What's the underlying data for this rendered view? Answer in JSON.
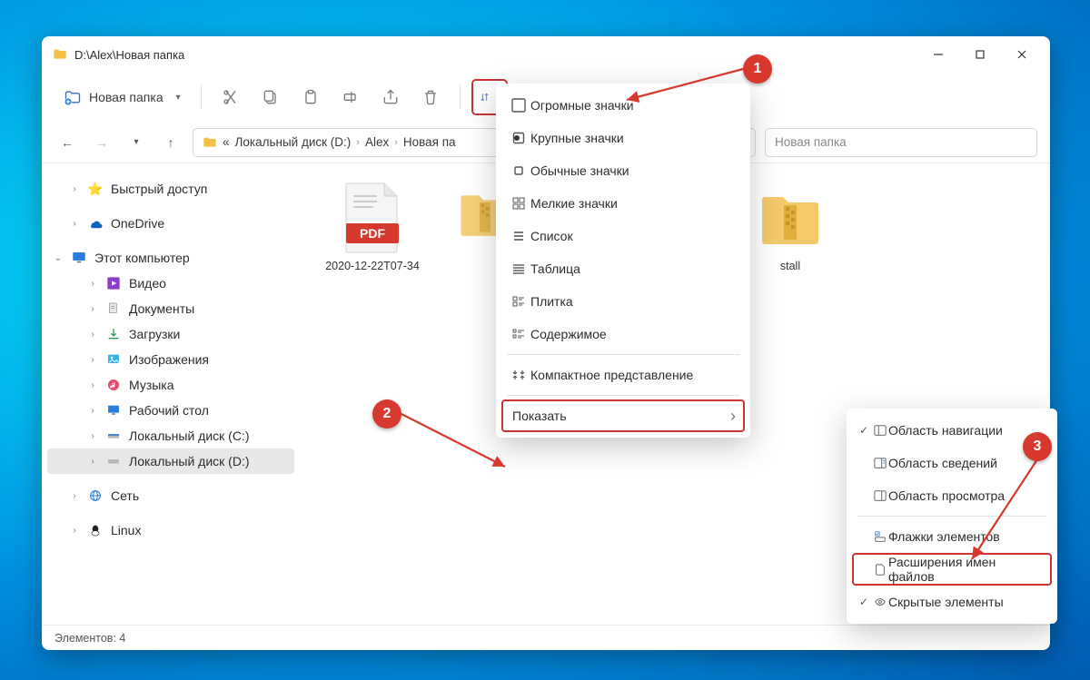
{
  "titlebar": {
    "path": "D:\\Alex\\Новая папка"
  },
  "toolbar": {
    "new_folder": "Новая папка"
  },
  "breadcrumb": {
    "segs": [
      "«",
      "Локальный диск (D:)",
      "Alex",
      "Новая па"
    ]
  },
  "search": {
    "placeholder": "Новая папка"
  },
  "sidebar": {
    "quick": "Быстрый доступ",
    "onedrive": "OneDrive",
    "thispc": "Этот компьютер",
    "video": "Видео",
    "documents": "Документы",
    "downloads": "Загрузки",
    "pictures": "Изображения",
    "music": "Музыка",
    "desktop": "Рабочий стол",
    "diskc": "Локальный диск (C:)",
    "diskd": "Локальный диск (D:)",
    "network": "Сеть",
    "linux": "Linux"
  },
  "files": {
    "pdf": "2020-12-22T07-34",
    "zip1_partial": "",
    "zip2_partial": "stall"
  },
  "status": {
    "count": "Элементов: 4"
  },
  "view_menu": {
    "items": [
      "Огромные значки",
      "Крупные значки",
      "Обычные значки",
      "Мелкие значки",
      "Список",
      "Таблица",
      "Плитка",
      "Содержимое"
    ],
    "compact": "Компактное представление",
    "show": "Показать"
  },
  "show_menu": {
    "items": [
      "Область навигации",
      "Область сведений",
      "Область просмотра",
      "Флажки элементов",
      "Расширения имен файлов",
      "Скрытые элементы"
    ]
  },
  "callouts": {
    "c1": "1",
    "c2": "2",
    "c3": "3"
  }
}
